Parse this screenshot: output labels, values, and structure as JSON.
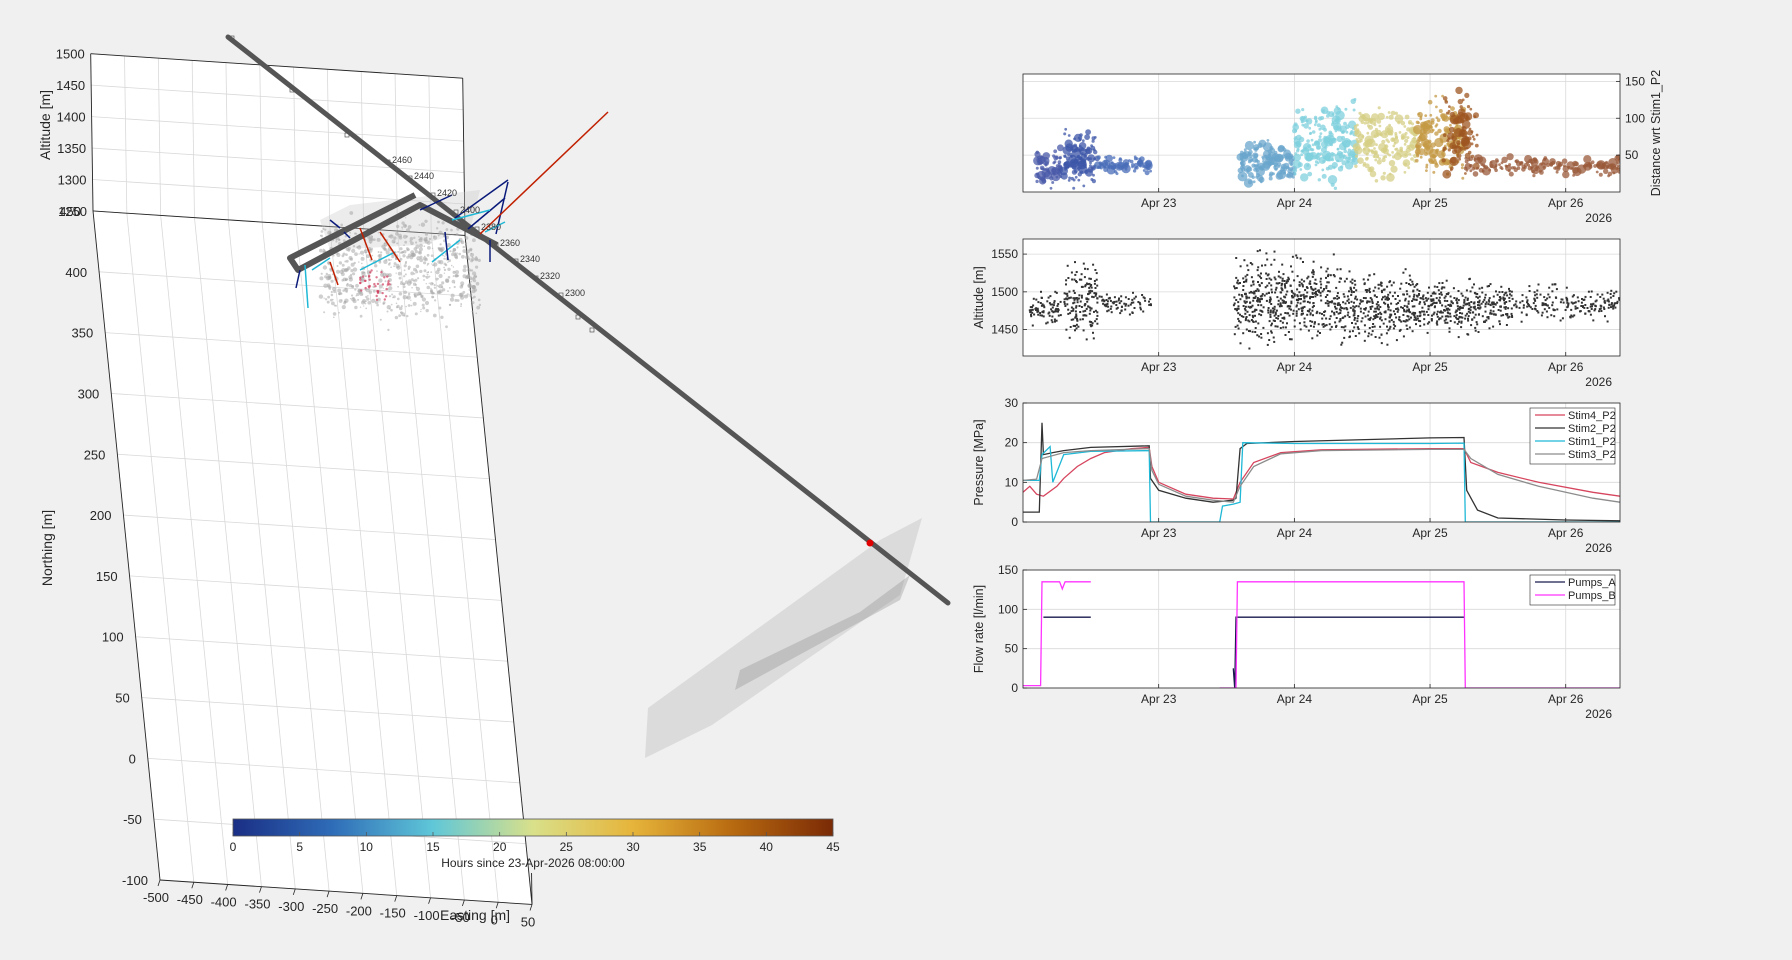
{
  "colors": {
    "background": "#f0f0f0",
    "axes_bg": "#ffffff",
    "grid": "#d9d9d9",
    "well": "#555555",
    "stim4_p2": "#d6455e",
    "stim2_p2": "#333333",
    "stim1_p2": "#1fb8d6",
    "stim3_p2": "#8c8c8c",
    "pumps_a": "#1a1a4e",
    "pumps_b": "#ff33ff",
    "red_marker": "#e00000"
  },
  "icons": [
    "depth-label-icon"
  ],
  "chart_data": [
    {
      "id": "view3d",
      "type": "scatter",
      "subtype": "3d-scatter",
      "title": "",
      "xlabel": "Easting [m]",
      "ylabel": "Northing [m]",
      "zlabel": "Altitude [m]",
      "x_ticks": [
        "-500",
        "-450",
        "-400",
        "-350",
        "-300",
        "-250",
        "-200",
        "-150",
        "-100",
        "-50",
        "0",
        "50"
      ],
      "y_ticks": [
        "-100",
        "-50",
        "0",
        "50",
        "100",
        "150",
        "200",
        "250",
        "300",
        "350",
        "400",
        "450"
      ],
      "z_ticks": [
        "1250",
        "1300",
        "1350",
        "1400",
        "1450",
        "1500"
      ],
      "xlim": [
        -500,
        50
      ],
      "ylim": [
        -100,
        450
      ],
      "zlim": [
        1250,
        1500
      ],
      "depth_labels": [
        "2460",
        "2440",
        "2420",
        "2400",
        "2380",
        "2360",
        "2340",
        "2320",
        "2300"
      ],
      "grid": true,
      "colorbar": {
        "label": "Hours since 23-Apr-2026 08:00:00",
        "ticks": [
          "0",
          "5",
          "10",
          "15",
          "20",
          "25",
          "30",
          "35",
          "40",
          "45"
        ],
        "range": [
          0,
          45
        ],
        "colormap": [
          "#1a2e85",
          "#2f6db8",
          "#5fc7d8",
          "#d9e08a",
          "#e6b43a",
          "#b86a10",
          "#7a2a05"
        ]
      }
    },
    {
      "id": "distance",
      "type": "scatter",
      "title": "",
      "xlabel": "",
      "ylabel": "Distance wrt Stim1_P2",
      "xlim": [
        22.0,
        26.4
      ],
      "ylim": [
        0,
        160
      ],
      "y_ticks": [
        50,
        100,
        150
      ],
      "y_axis_side": "right",
      "x_ticks": [
        23,
        24,
        25,
        26
      ],
      "x_tick_labels": [
        "Apr 23",
        "Apr 24",
        "Apr 25",
        "Apr 26"
      ],
      "x_year": "2026",
      "grid": true,
      "colored_by": "hours since start",
      "clusters": [
        {
          "x_range": [
            22.1,
            22.28
          ],
          "y_range": [
            5,
            60
          ],
          "color": "#4a5aa8",
          "n": 60
        },
        {
          "x_range": [
            22.3,
            22.55
          ],
          "y_range": [
            5,
            85
          ],
          "color": "#3e57a8",
          "n": 120
        },
        {
          "x_range": [
            22.55,
            22.95
          ],
          "y_range": [
            25,
            50
          ],
          "color": "#4a6eb8",
          "n": 80
        },
        {
          "x_range": [
            23.6,
            24.0
          ],
          "y_range": [
            5,
            70
          ],
          "color": "#6aa6cc",
          "n": 150
        },
        {
          "x_range": [
            24.0,
            24.45
          ],
          "y_range": [
            5,
            130
          ],
          "color": "#7fd0de",
          "n": 200
        },
        {
          "x_range": [
            24.45,
            24.9
          ],
          "y_range": [
            15,
            120
          ],
          "color": "#d5cf86",
          "n": 170
        },
        {
          "x_range": [
            24.9,
            25.25
          ],
          "y_range": [
            15,
            130
          ],
          "color": "#c49a44",
          "n": 170
        },
        {
          "x_range": [
            25.1,
            25.35
          ],
          "y_range": [
            20,
            140
          ],
          "color": "#9e5522",
          "n": 90
        },
        {
          "x_range": [
            25.25,
            26.4
          ],
          "y_range": [
            20,
            50
          ],
          "color": "#9a5a3a",
          "n": 150
        }
      ]
    },
    {
      "id": "altitude",
      "type": "scatter",
      "title": "",
      "xlabel": "",
      "ylabel": "Altitude [m]",
      "xlim": [
        22.0,
        26.4
      ],
      "ylim": [
        1415,
        1570
      ],
      "y_ticks": [
        1450,
        1500,
        1550
      ],
      "x_ticks": [
        23,
        24,
        25,
        26
      ],
      "x_tick_labels": [
        "Apr 23",
        "Apr 24",
        "Apr 25",
        "Apr 26"
      ],
      "x_year": "2026",
      "grid": true,
      "color": "#333333",
      "clusters": [
        {
          "x_range": [
            22.05,
            22.28
          ],
          "y_range": [
            1452,
            1500
          ],
          "n": 80
        },
        {
          "x_range": [
            22.3,
            22.55
          ],
          "y_range": [
            1435,
            1545
          ],
          "n": 160
        },
        {
          "x_range": [
            22.55,
            22.95
          ],
          "y_range": [
            1470,
            1500
          ],
          "n": 80
        },
        {
          "x_range": [
            23.55,
            24.3
          ],
          "y_range": [
            1425,
            1555
          ],
          "n": 500
        },
        {
          "x_range": [
            24.3,
            25.0
          ],
          "y_range": [
            1430,
            1530
          ],
          "n": 400
        },
        {
          "x_range": [
            25.0,
            25.6
          ],
          "y_range": [
            1440,
            1520
          ],
          "n": 300
        },
        {
          "x_range": [
            25.6,
            26.4
          ],
          "y_range": [
            1460,
            1510
          ],
          "n": 200
        }
      ]
    },
    {
      "id": "pressure",
      "type": "line",
      "title": "",
      "xlabel": "",
      "ylabel": "Pressure [MPa]",
      "xlim": [
        22.0,
        26.4
      ],
      "ylim": [
        0,
        30
      ],
      "y_ticks": [
        0,
        10,
        20,
        30
      ],
      "x_ticks": [
        23,
        24,
        25,
        26
      ],
      "x_tick_labels": [
        "Apr 23",
        "Apr 24",
        "Apr 25",
        "Apr 26"
      ],
      "x_year": "2026",
      "grid": true,
      "legend": "top-right",
      "series": [
        {
          "name": "Stim4_P2",
          "color": "#d6455e",
          "points": [
            [
              22.0,
              7.5
            ],
            [
              22.05,
              9
            ],
            [
              22.1,
              7
            ],
            [
              22.15,
              6.5
            ],
            [
              22.25,
              9
            ],
            [
              22.3,
              11
            ],
            [
              22.4,
              14
            ],
            [
              22.5,
              16
            ],
            [
              22.6,
              17.5
            ],
            [
              22.7,
              18
            ],
            [
              22.8,
              18.5
            ],
            [
              22.93,
              18.8
            ],
            [
              22.95,
              14
            ],
            [
              23.0,
              10
            ],
            [
              23.2,
              7
            ],
            [
              23.4,
              6
            ],
            [
              23.55,
              5.8
            ],
            [
              23.6,
              10
            ],
            [
              23.7,
              15
            ],
            [
              23.9,
              17.5
            ],
            [
              24.2,
              18.2
            ],
            [
              25.0,
              18.5
            ],
            [
              25.25,
              18.5
            ],
            [
              25.3,
              15
            ],
            [
              25.5,
              12.5
            ],
            [
              25.8,
              10
            ],
            [
              26.2,
              7.5
            ],
            [
              26.4,
              6.5
            ]
          ]
        },
        {
          "name": "Stim2_P2",
          "color": "#333333",
          "points": [
            [
              22.0,
              2.5
            ],
            [
              22.12,
              2.5
            ],
            [
              22.14,
              25
            ],
            [
              22.15,
              17
            ],
            [
              22.22,
              17.5
            ],
            [
              22.3,
              18
            ],
            [
              22.5,
              18.8
            ],
            [
              22.93,
              19.2
            ],
            [
              22.94,
              11
            ],
            [
              23.0,
              8
            ],
            [
              23.2,
              6
            ],
            [
              23.4,
              5
            ],
            [
              23.55,
              5.5
            ],
            [
              23.57,
              6
            ],
            [
              23.6,
              18.5
            ],
            [
              23.65,
              19.8
            ],
            [
              24.0,
              20.3
            ],
            [
              25.0,
              21.2
            ],
            [
              25.25,
              21.3
            ],
            [
              25.27,
              8
            ],
            [
              25.35,
              3
            ],
            [
              25.5,
              1
            ],
            [
              26.0,
              0.5
            ],
            [
              26.4,
              0.3
            ]
          ]
        },
        {
          "name": "Stim1_P2",
          "color": "#1fb8d6",
          "points": [
            [
              22.0,
              10.5
            ],
            [
              22.12,
              10.5
            ],
            [
              22.14,
              17
            ],
            [
              22.2,
              19
            ],
            [
              22.22,
              10
            ],
            [
              22.3,
              17
            ],
            [
              22.5,
              17.8
            ],
            [
              22.93,
              18
            ],
            [
              22.94,
              0
            ],
            [
              23.0,
              0
            ],
            [
              23.2,
              0
            ],
            [
              23.4,
              0
            ],
            [
              23.45,
              0
            ],
            [
              23.47,
              4
            ],
            [
              23.55,
              4.5
            ],
            [
              23.6,
              5
            ],
            [
              23.62,
              20
            ],
            [
              24.0,
              19.8
            ],
            [
              25.0,
              19.8
            ],
            [
              25.25,
              19.9
            ],
            [
              25.26,
              0
            ],
            [
              25.5,
              0
            ],
            [
              26.0,
              0
            ],
            [
              26.4,
              0
            ]
          ]
        },
        {
          "name": "Stim3_P2",
          "color": "#8c8c8c",
          "points": [
            [
              22.0,
              10.5
            ],
            [
              22.1,
              10.8
            ],
            [
              22.14,
              16
            ],
            [
              22.3,
              17.5
            ],
            [
              22.5,
              18
            ],
            [
              22.93,
              18.5
            ],
            [
              22.95,
              13
            ],
            [
              23.0,
              9.5
            ],
            [
              23.2,
              6.5
            ],
            [
              23.4,
              5.5
            ],
            [
              23.55,
              5
            ],
            [
              23.6,
              9
            ],
            [
              23.7,
              14
            ],
            [
              23.9,
              17.2
            ],
            [
              24.2,
              18
            ],
            [
              25.0,
              18.3
            ],
            [
              25.25,
              18.3
            ],
            [
              25.3,
              16
            ],
            [
              25.5,
              12
            ],
            [
              25.8,
              9
            ],
            [
              26.2,
              6
            ],
            [
              26.4,
              5
            ]
          ]
        }
      ]
    },
    {
      "id": "flowrate",
      "type": "line",
      "title": "",
      "xlabel": "",
      "ylabel": "Flow rate [l/min]",
      "xlim": [
        22.0,
        26.4
      ],
      "ylim": [
        0,
        150
      ],
      "y_ticks": [
        0,
        50,
        100,
        150
      ],
      "x_ticks": [
        23,
        24,
        25,
        26
      ],
      "x_tick_labels": [
        "Apr 23",
        "Apr 24",
        "Apr 25",
        "Apr 26"
      ],
      "x_year": "2026",
      "grid": true,
      "legend": "top-right",
      "series": [
        {
          "name": "Pumps_A",
          "color": "#1a1a4e",
          "segments": [
            [
              [
                22.15,
                90
              ],
              [
                22.5,
                90
              ]
            ],
            [
              [
                23.55,
                25
              ],
              [
                23.56,
                0
              ],
              [
                23.57,
                90
              ],
              [
                25.25,
                90
              ]
            ]
          ]
        },
        {
          "name": "Pumps_B",
          "color": "#ff33ff",
          "segments": [
            [
              [
                22.0,
                3
              ],
              [
                22.13,
                3
              ],
              [
                22.14,
                135
              ],
              [
                22.27,
                135
              ],
              [
                22.29,
                126
              ],
              [
                22.31,
                135
              ],
              [
                22.5,
                135
              ]
            ],
            [
              [
                23.45,
                0
              ],
              [
                23.57,
                0
              ],
              [
                23.58,
                135
              ],
              [
                25.25,
                135
              ],
              [
                25.26,
                0
              ],
              [
                26.4,
                0
              ]
            ]
          ]
        }
      ]
    }
  ]
}
